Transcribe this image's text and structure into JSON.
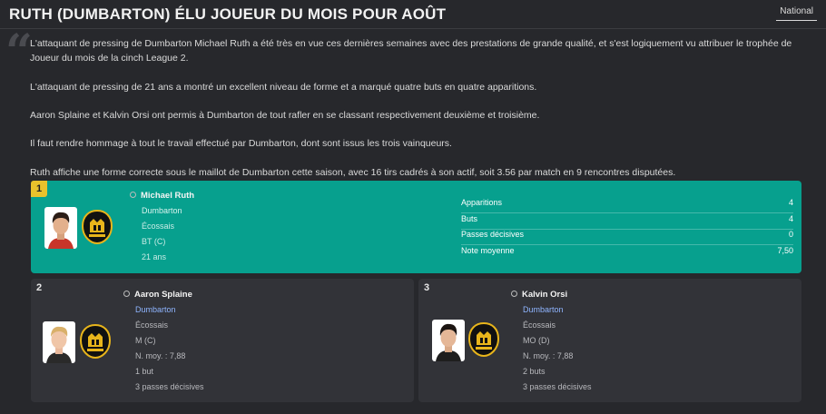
{
  "header": {
    "title": "RUTH (DUMBARTON) ÉLU JOUEUR DU MOIS POUR AOÛT",
    "tag": "National"
  },
  "article": {
    "quote_mark": "“",
    "paragraphs": [
      "L'attaquant de pressing de Dumbarton Michael Ruth a été très en vue ces dernières semaines avec des prestations de grande qualité, et s'est logiquement vu attribuer le trophée de Joueur du mois de la cinch League 2.",
      "L'attaquant de pressing de 21 ans a montré un excellent niveau de forme et a marqué quatre buts en quatre apparitions.",
      "Aaron Splaine et Kalvin Orsi ont permis à Dumbarton de tout rafler en se classant respectivement deuxième et troisième.",
      "Il faut rendre hommage à tout le travail effectué par Dumbarton, dont sont issus les trois vainqueurs.",
      "Ruth affiche une forme correcte sous le maillot de Dumbarton cette saison, avec 16 tirs cadrés à son actif, soit 3.56 par match en 9 rencontres disputées."
    ]
  },
  "winner": {
    "rank": "1",
    "name": "Michael Ruth",
    "club": "Dumbarton",
    "nationality": "Écossais",
    "position": "BT (C)",
    "age": "21 ans",
    "stats": [
      {
        "label": "Apparitions",
        "value": "4"
      },
      {
        "label": "Buts",
        "value": "4"
      },
      {
        "label": "Passes décisives",
        "value": "0"
      },
      {
        "label": "Note moyenne",
        "value": "7,50"
      }
    ]
  },
  "runners_up": [
    {
      "rank": "2",
      "name": "Aaron Splaine",
      "club": "Dumbarton",
      "nationality": "Écossais",
      "position": "M (C)",
      "rating": "N. moy. : 7,88",
      "goals": "1 but",
      "assists": "3 passes décisives"
    },
    {
      "rank": "3",
      "name": "Kalvin Orsi",
      "club": "Dumbarton",
      "nationality": "Écossais",
      "position": "MO (D)",
      "rating": "N. moy. : 7,88",
      "goals": "2 buts",
      "assists": "3 passes décisives"
    }
  ],
  "colors": {
    "background": "#27282c",
    "winner_card": "#07a08e",
    "card": "#323338",
    "rank_badge": "#e9c22c",
    "link": "#8fb5ff",
    "crest_black": "#111111",
    "crest_gold": "#e8b51b"
  }
}
